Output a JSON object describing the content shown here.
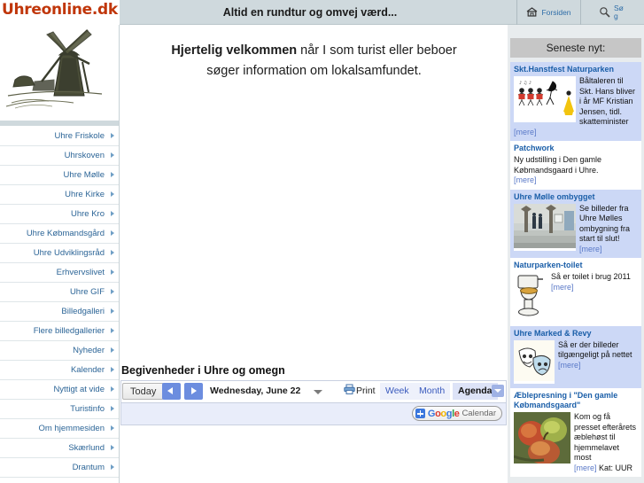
{
  "header": {
    "logo": "Uhreonline.dk",
    "slogan": "Altid en rundtur og omvej værd...",
    "home_label": "Forsiden",
    "search_label": "Søg"
  },
  "sidebar": {
    "items": [
      {
        "label": "Uhre Friskole"
      },
      {
        "label": "Uhrskoven"
      },
      {
        "label": "Uhre Mølle"
      },
      {
        "label": "Uhre Kirke"
      },
      {
        "label": "Uhre Kro"
      },
      {
        "label": "Uhre Købmandsgård"
      },
      {
        "label": "Uhre Udviklingsråd"
      },
      {
        "label": "Erhvervslivet"
      },
      {
        "label": "Uhre GIF"
      },
      {
        "label": "Billedgalleri"
      },
      {
        "label": "Flere billedgallerier"
      },
      {
        "label": "Nyheder"
      },
      {
        "label": "Kalender"
      },
      {
        "label": "Nyttigt at vide"
      },
      {
        "label": "Turistinfo"
      },
      {
        "label": "Om hjemmesiden"
      },
      {
        "label": "Skærlund"
      },
      {
        "label": "Drantum"
      }
    ]
  },
  "main": {
    "welcome_bold": "Hjertelig velkommen",
    "welcome_rest": " når I som turist eller beboer",
    "welcome_line2": "søger information om lokalsamfundet."
  },
  "calendar": {
    "title": "Begivenheder i Uhre og omegn",
    "today_label": "Today",
    "current_date": "Wednesday, June 22",
    "print_label": "Print",
    "week_label": "Week",
    "month_label": "Month",
    "agenda_label": "Agenda",
    "badge_plus": "+",
    "badge_g": "G",
    "badge_o1": "o",
    "badge_o2": "o",
    "badge_g2": "g",
    "badge_l": "l",
    "badge_e": "e",
    "badge_calendar": "Calendar"
  },
  "news": {
    "heading": "Seneste nyt:",
    "more_label": "[mere]",
    "items": [
      {
        "title": "Skt.Hanstfest Naturparken",
        "body": "Båltaleren til Skt. Hans bliver i år MF Kristian Jensen, tidl. skatteminister",
        "more": "[mere]",
        "thumb": "bonfire-dancers-illustration",
        "has_thumb": true,
        "shade": "alt"
      },
      {
        "title": "Patchwork",
        "body": "Ny udstilling i Den gamle Købmandsgaard i Uhre.",
        "more": "[mere]",
        "has_thumb": false,
        "shade": "plain"
      },
      {
        "title": "Uhre Mølle ombygget",
        "body": "Se billeder fra Uhre Mølles ombygning fra start til slut!",
        "more": "[mere]",
        "thumb": "mill-interior-photo",
        "has_thumb": true,
        "shade": "alt"
      },
      {
        "title": "Naturparken-toilet",
        "body": "Så er toilet i brug 2011",
        "more": "[mere]",
        "thumb": "toilet-illustration",
        "has_thumb": true,
        "shade": "plain"
      },
      {
        "title": "Uhre Marked & Revy",
        "body": "Så er der billeder tilgængeligt på nettet",
        "more": "[mere]",
        "thumb": "theatre-masks-illustration",
        "has_thumb": true,
        "shade": "alt"
      },
      {
        "title": "Æblepresning i \"Den gamle Købmandsgaard\"",
        "body": "Kom og få presset efterårets æblehøst til hjemmelavet most",
        "more": "[mere]",
        "kat": "Kat: UUR",
        "thumb": "apples-photo",
        "has_thumb": true,
        "shade": "plain"
      }
    ]
  },
  "colors": {
    "brand": "#c0360a",
    "header_bg": "#cfd9dd",
    "link": "#2c6597",
    "news_alt_bg": "#ccd8f6",
    "right_bg": "#e8ecee"
  }
}
